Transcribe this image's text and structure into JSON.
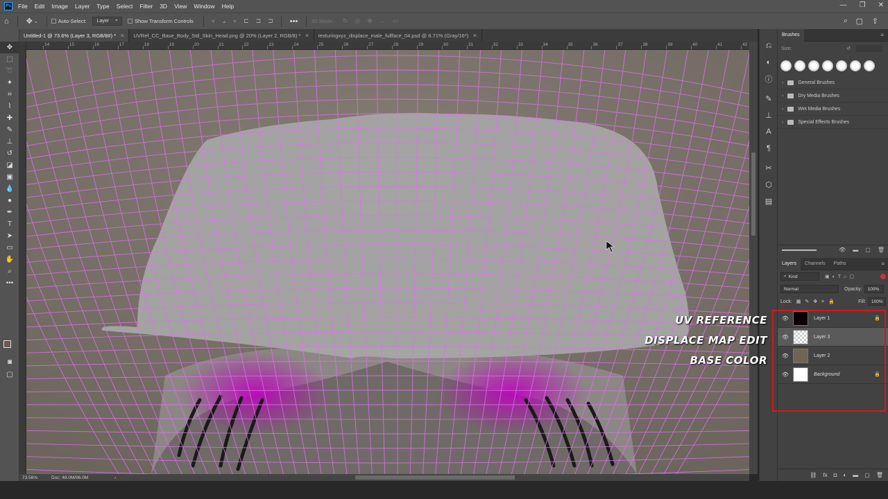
{
  "menu": [
    "File",
    "Edit",
    "Image",
    "Layer",
    "Type",
    "Select",
    "Filter",
    "3D",
    "View",
    "Window",
    "Help"
  ],
  "options": {
    "auto_select_label": "Auto-Select:",
    "auto_select_value": "Layer",
    "transform_label": "Show Transform Controls",
    "mode_3d": "3D Mode:"
  },
  "tabs": [
    {
      "label": "Untitled-1 @ 73.6% (Layer 3, RGB/8#) *",
      "active": true
    },
    {
      "label": "UVRef_CC_Base_Body_Std_Skin_Head.png @ 20% (Layer 2, RGB/8) *",
      "active": false
    },
    {
      "label": "texturingxyz_displace_male_fullface_04.psd @ 8.71% (Gray/16*)",
      "active": false
    }
  ],
  "ruler": [
    "14",
    "15",
    "16",
    "17",
    "18",
    "19",
    "20",
    "21",
    "22",
    "23",
    "24",
    "25",
    "26",
    "27",
    "28",
    "29",
    "30",
    "31",
    "32",
    "33",
    "34",
    "35",
    "36",
    "37",
    "38",
    "39",
    "40",
    "41",
    "42"
  ],
  "status": {
    "zoom": "73.56%",
    "doc": "Doc: 48.0M/96.0M"
  },
  "brushes": {
    "panel_title": "Brushes",
    "size_label": "Size:",
    "folders": [
      "General Brushes",
      "Dry Media Brushes",
      "Wet Media Brushes",
      "Special Effects Brushes"
    ]
  },
  "layers_panel": {
    "tabs": [
      "Layers",
      "Channels",
      "Paths"
    ],
    "filter": "Kind",
    "blend_mode": "Normal",
    "opacity_label": "Opacity:",
    "opacity_value": "100%",
    "lock_label": "Lock:",
    "fill_label": "Fill:",
    "fill_value": "100%",
    "layers": [
      {
        "name": "Layer 1",
        "locked": true,
        "selected": false,
        "thumb": "#0a0008"
      },
      {
        "name": "Layer 3",
        "locked": false,
        "selected": true,
        "thumb": "#d8d8d8"
      },
      {
        "name": "Layer 2",
        "locked": false,
        "selected": false,
        "thumb": "#6f6456"
      },
      {
        "name": "Background",
        "locked": true,
        "selected": false,
        "thumb": "#ffffff"
      }
    ]
  },
  "annotations": [
    "UV REFERENCE",
    "DISPLACE MAP EDIT",
    "BASE COLOR"
  ],
  "colors": {
    "highlight": "#d31919",
    "uv_wire": "#e070f0",
    "patch": "#a7a7a7",
    "skin": "#7a736c"
  }
}
